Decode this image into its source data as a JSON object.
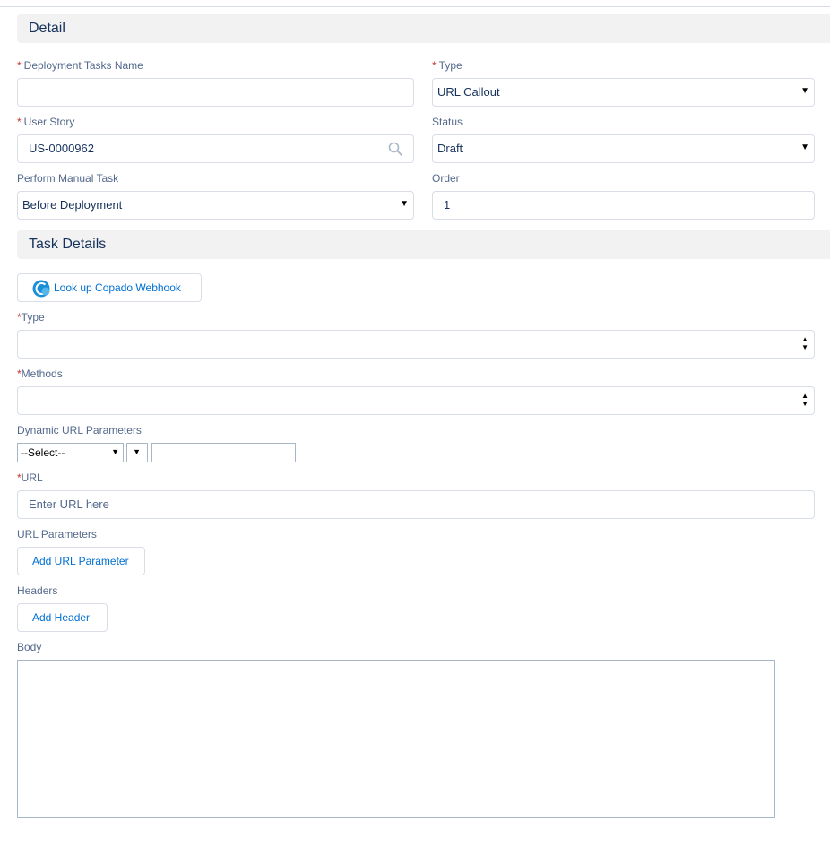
{
  "detail_section": {
    "title": "Detail",
    "deployment_tasks_name": {
      "label": "Deployment Tasks Name",
      "required_mark": "*",
      "value": ""
    },
    "type": {
      "label": "Type",
      "required_mark": "*",
      "value": "URL Callout"
    },
    "user_story": {
      "label": "User Story",
      "required_mark": "*",
      "value": "US-0000962",
      "icon": "search-icon"
    },
    "status": {
      "label": "Status",
      "value": "Draft"
    },
    "perform_manual_task": {
      "label": "Perform Manual Task",
      "value": "Before Deployment"
    },
    "order": {
      "label": "Order",
      "value": "1"
    }
  },
  "task_details_section": {
    "title": "Task Details",
    "lookup_button": {
      "label": "Look up Copado Webhook",
      "icon": "copado-webhook-icon"
    },
    "type": {
      "label": "Type",
      "required_mark": "*",
      "value": ""
    },
    "methods": {
      "label": "Methods",
      "required_mark": "*",
      "value": ""
    },
    "dynamic_url_parameters": {
      "label": "Dynamic URL Parameters",
      "select_value": "--Select--",
      "second_select_value": "",
      "input_value": ""
    },
    "url": {
      "label": "URL",
      "required_mark": "*",
      "placeholder": "Enter URL here"
    },
    "url_parameters": {
      "label": "URL Parameters",
      "button_label": "Add URL Parameter"
    },
    "headers": {
      "label": "Headers",
      "button_label": "Add Header"
    },
    "body": {
      "label": "Body",
      "value": ""
    }
  },
  "colors": {
    "label": "#54698d",
    "text": "#16325c",
    "link": "#0070d2",
    "required": "#c23934",
    "section_bg": "#f3f2f2",
    "border": "#d8dde6"
  }
}
